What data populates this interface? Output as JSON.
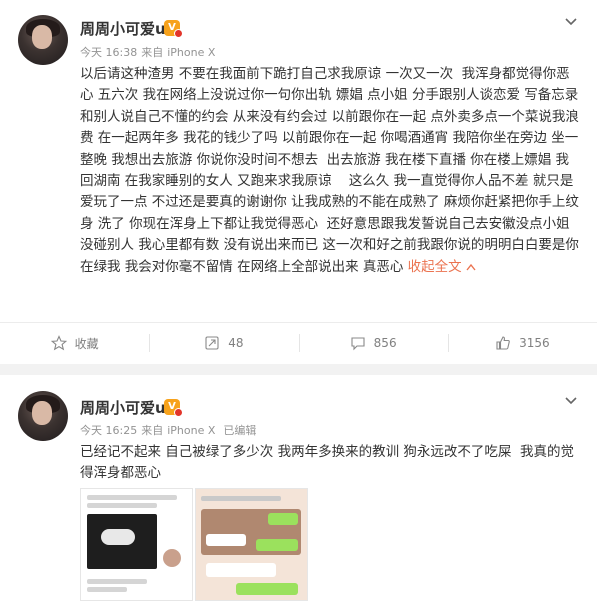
{
  "colors": {
    "link": "#eb7350",
    "meta": "#939393",
    "vip": "#f7a21b"
  },
  "posts": [
    {
      "username": "周周小可爱u",
      "vip_icon": "vip-badge-icon",
      "time": "今天 16:38",
      "source_prefix": "来自",
      "source": "iPhone X",
      "edited": "",
      "text": "以后请这种渣男 不要在我面前下跪打自己求我原谅 一次又一次  我浑身都觉得你恶心 五六次 我在网络上没说过你一句你出轨 嫖娼 点小姐 分手跟别人谈恋爱 写备忘录 和别人说自己不懂的约会 从来没有约会过 以前跟你在一起 点外卖多点一个菜说我浪费 在一起两年多 我花的钱少了吗 以前跟你在一起 你喝酒通宵 我陪你坐在旁边 坐一整晚 我想出去旅游 你说你没时间不想去  出去旅游 我在楼下直播 你在楼上嫖娼 我回湖南 在我家睡别的女人 又跑来求我原谅    这么久 我一直觉得你人品不差 就只是爱玩了一点 不过还是要真的谢谢你 让我成熟的不能在成熟了 麻烦你赶紧把你手上纹身 洗了 你现在浑身上下都让我觉得恶心  还好意思跟我发誓说自己去安徽没点小姐没碰别人 我心里都有数 没有说出来而已 这一次和好之前我跟你说的明明白白要是你在绿我 我会对你毫不留情 在网络上全部说出来 真恶心",
      "expand": "收起全文",
      "actions": {
        "favorite": "收藏",
        "repost": "48",
        "comment": "856",
        "like": "3156"
      }
    },
    {
      "username": "周周小可爱u",
      "vip_icon": "vip-badge-icon",
      "time": "今天 16:25",
      "source_prefix": "来自",
      "source": "iPhone X",
      "edited": "已编辑",
      "text": "已经记不起来 自己被绿了多少次 我两年多换来的教训 狗永远改不了吃屎  我真的觉得浑身都恶心"
    }
  ]
}
